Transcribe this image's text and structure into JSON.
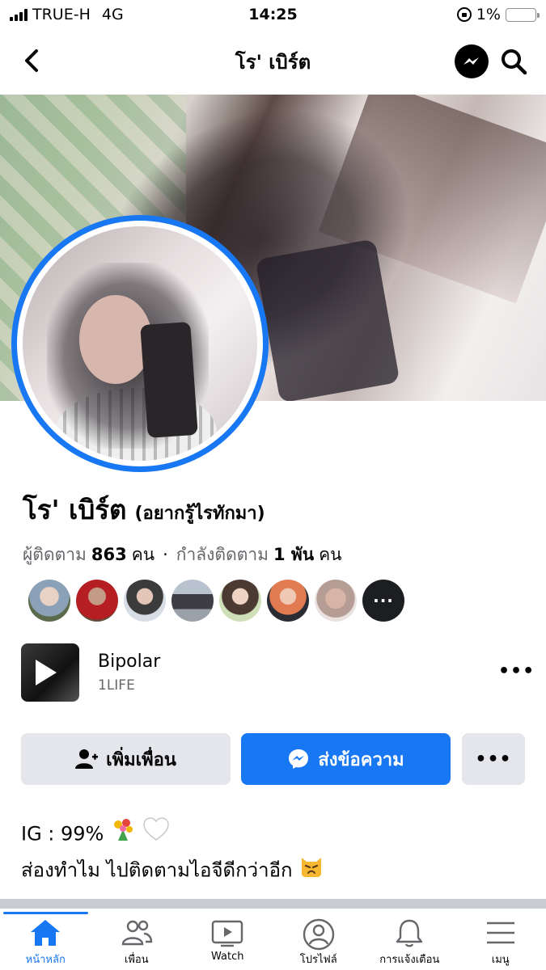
{
  "status_bar": {
    "carrier": "TRUE-H",
    "network": "4G",
    "time": "14:25",
    "battery": "1%",
    "battery_level": 0.01
  },
  "header": {
    "title": "โร' เบิร์ต"
  },
  "profile": {
    "name": "โร' เบิร์ต",
    "alt_name": "(อยากรู้ไรทักมา)",
    "followers_label": "ผู้ติดตาม",
    "followers_count": "863",
    "followers_unit": "คน",
    "separator": "·",
    "following_label": "กำลังติดตาม",
    "following_count": "1 พัน",
    "following_unit": "คน",
    "friends_more": "···"
  },
  "music": {
    "title": "Bipolar",
    "artist": "1LIFE",
    "more": "•••"
  },
  "actions": {
    "add_friend": "เพิ่มเพื่อน",
    "message": "ส่งข้อความ",
    "more": "•••"
  },
  "bio": {
    "line1": "IG : 99%",
    "line2": "ส่องทำไม ไปติดตามไอจีดีกว่าอีก"
  },
  "bottom_nav": [
    {
      "label": "หน้าหลัก",
      "icon": "home-icon",
      "active": true
    },
    {
      "label": "เพื่อน",
      "icon": "friends-icon"
    },
    {
      "label": "Watch",
      "icon": "watch-icon"
    },
    {
      "label": "โปรไฟล์",
      "icon": "profile-icon"
    },
    {
      "label": "การแจ้งเตือน",
      "icon": "bell-icon"
    },
    {
      "label": "เมนู",
      "icon": "menu-icon"
    }
  ],
  "colors": {
    "accent": "#1877f2",
    "button_gray": "#e4e6eb",
    "secondary_text": "#65676b"
  }
}
